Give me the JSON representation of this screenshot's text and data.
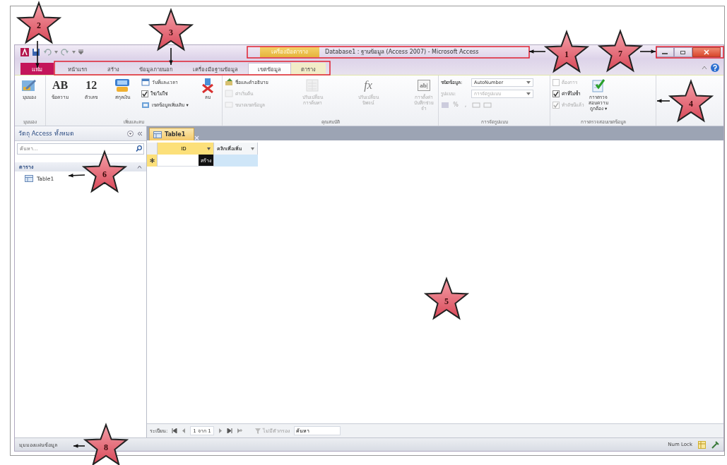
{
  "title_bar": {
    "contextual_tab": "เครื่องมือตาราง",
    "title": "Database1 : ฐานข้อมูล (Access 2007) - Microsoft Access"
  },
  "tabs": [
    {
      "label": "แฟ้ม",
      "kind": "file",
      "selected": false
    },
    {
      "label": "หน้าแรก",
      "kind": "normal",
      "selected": false
    },
    {
      "label": "สร้าง",
      "kind": "normal",
      "selected": false
    },
    {
      "label": "ข้อมูลภายนอก",
      "kind": "normal",
      "selected": false
    },
    {
      "label": "เครื่องมือฐานข้อมูล",
      "kind": "normal",
      "selected": false
    },
    {
      "label": "เขตข้อมูล",
      "kind": "contextual",
      "selected": true
    },
    {
      "label": "ตาราง",
      "kind": "contextual",
      "selected": false
    }
  ],
  "ribbon_groups": [
    {
      "label": "มุมมอง",
      "items": [
        {
          "kind": "large",
          "label": "มุมมอง",
          "disabled": false
        }
      ]
    },
    {
      "label": "เพิ่มและลบ",
      "items": [
        {
          "kind": "large",
          "glyph": "AB",
          "label": "ข้อความ",
          "disabled": false
        },
        {
          "kind": "large",
          "glyph": "12",
          "label": "ตัวเลข",
          "disabled": false
        },
        {
          "kind": "large",
          "label": "สกุลเงิน",
          "disabled": false
        },
        {
          "kind": "column",
          "items": [
            {
              "kind": "small",
              "label": "วันที่และเวลา",
              "disabled": false
            },
            {
              "kind": "check",
              "label": "ใช่/ไม่ใช่",
              "checked": true,
              "disabled": false
            },
            {
              "kind": "small",
              "label": "เขตข้อมูลเพิ่มเติม ▾",
              "disabled": false
            }
          ]
        },
        {
          "kind": "large",
          "label": "ลบ",
          "disabled": false
        }
      ]
    },
    {
      "label": "คุณสมบัติ",
      "items": [
        {
          "kind": "column",
          "items": [
            {
              "kind": "small",
              "label": "ชื่อและคำอธิบาย",
              "disabled": false
            },
            {
              "kind": "small",
              "label": "ค่าเริ่มต้น",
              "disabled": true
            },
            {
              "kind": "small",
              "label": "ขนาดเขตข้อมูล",
              "disabled": true
            }
          ]
        },
        {
          "kind": "large",
          "label": "ปรับเปลี่ยนการค้นหา",
          "disabled": true
        },
        {
          "kind": "large",
          "glyph": "fx",
          "label": "ปรับเปลี่ยนนิพจน์",
          "disabled": true
        },
        {
          "kind": "large",
          "glyph": "ab|",
          "label": "การตั้งค่าบันทึกช่วยจำ",
          "disabled": true
        }
      ]
    },
    {
      "label": "การจัดรูปแบบ",
      "items": [
        {
          "kind": "column",
          "items": [
            {
              "kind": "dropdown",
              "label": "ชนิดข้อมูล:",
              "value": "AutoNumber",
              "disabled": false
            },
            {
              "kind": "dropdown",
              "label": "รูปแบบ:",
              "value": "การจัดรูปแบบ",
              "disabled": true
            },
            {
              "kind": "format",
              "symbols": [
                "%",
                ","
              ],
              "disabled": true
            }
          ]
        }
      ]
    },
    {
      "label": "การตรวจสอบเขตข้อมูล",
      "items": [
        {
          "kind": "column",
          "items": [
            {
              "kind": "check",
              "label": "ต้องการ",
              "checked": false,
              "disabled": true
            },
            {
              "kind": "check",
              "label": "ค่าที่ไม่ซ้ำ",
              "checked": true,
              "disabled": false
            },
            {
              "kind": "check",
              "label": "ทำดัชนีแล้ว",
              "checked": true,
              "disabled": true
            }
          ]
        },
        {
          "kind": "large",
          "label": "การตรวจสอบความถูกต้อง ▾",
          "disabled": false
        }
      ]
    }
  ],
  "navigation_pane": {
    "title": "วัตถุ Access ทั้งหมด",
    "search_placeholder": "ค้นหา...",
    "groups": [
      {
        "label": "ตาราง",
        "items": [
          {
            "label": "Table1",
            "selected": false
          }
        ]
      }
    ]
  },
  "document": {
    "tab": "Table1",
    "columns": [
      {
        "label": "ID",
        "kind": "key"
      },
      {
        "label": "คลิกเพื่อเพิ่ม",
        "kind": "add"
      }
    ],
    "new_row_cell": "สร้าง"
  },
  "record_navigation": {
    "label": "ระเบียน:",
    "position": "1 จาก 1",
    "filter": "ไม่มีตัวกรอง",
    "search": "ค้นหา"
  },
  "status_bar": {
    "left": "มุมมองแผ่นข้อมูล",
    "right": "Num Lock"
  },
  "annotations": [
    {
      "number": "1"
    },
    {
      "number": "2"
    },
    {
      "number": "3"
    },
    {
      "number": "4"
    },
    {
      "number": "5"
    },
    {
      "number": "6"
    },
    {
      "number": "7"
    },
    {
      "number": "8"
    }
  ]
}
